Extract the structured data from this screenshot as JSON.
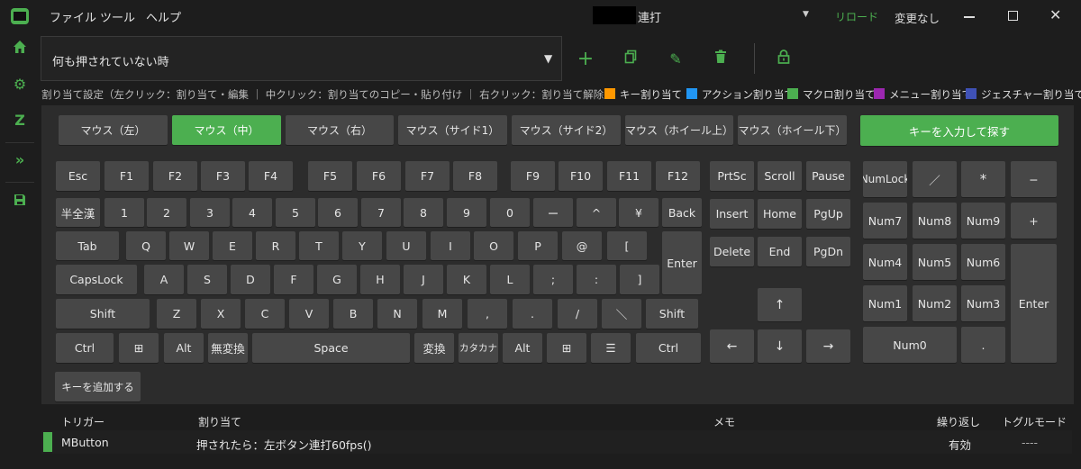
{
  "menu": [
    "ファイル",
    "ツール",
    "ヘルプ"
  ],
  "title": {
    "suffix": "連打"
  },
  "header": {
    "reload": "リロード",
    "status": "変更なし"
  },
  "dropdown": {
    "value": "何も押されていない時"
  },
  "hint": "割り当て設定（左クリック：割り当て・編集 ｜ 中クリック：割り当てのコピー・貼り付け ｜ 右クリック：割り当て解除）",
  "legend": [
    {
      "label": "キー割り当て",
      "color": "#ff9800"
    },
    {
      "label": "アクション割り当て",
      "color": "#2196f3"
    },
    {
      "label": "マクロ割り当て",
      "color": "#4caf50"
    },
    {
      "label": "メニュー割り当て",
      "color": "#9c27b0"
    },
    {
      "label": "ジェスチャー割り当て",
      "color": "#3f51b5"
    }
  ],
  "mouse": [
    "マウス（左）",
    "マウス（中）",
    "マウス（右）",
    "マウス（サイド1）",
    "マウス（サイド2）",
    "マウス（ホイール上）",
    "マウス（ホイール下）"
  ],
  "search_label": "キーを入力して探す",
  "add_key_label": "キーを追加する",
  "keys": {
    "fn": [
      "Esc",
      "F1",
      "F2",
      "F3",
      "F4",
      "F5",
      "F6",
      "F7",
      "F8",
      "F9",
      "F10",
      "F11",
      "F12"
    ],
    "num": [
      "半全漢",
      "1",
      "2",
      "3",
      "4",
      "5",
      "6",
      "7",
      "8",
      "9",
      "0",
      "ー",
      "^",
      "¥",
      "Back"
    ],
    "tab": [
      "Tab",
      "Q",
      "W",
      "E",
      "R",
      "T",
      "Y",
      "U",
      "I",
      "O",
      "P",
      "@",
      "["
    ],
    "caps": [
      "CapsLock",
      "A",
      "S",
      "D",
      "F",
      "G",
      "H",
      "J",
      "K",
      "L",
      ";",
      ":",
      "]"
    ],
    "shift": [
      "Shift",
      "Z",
      "X",
      "C",
      "V",
      "B",
      "N",
      "M",
      ",",
      ".",
      "/",
      "＼",
      "Shift"
    ],
    "bottom": [
      "Ctrl",
      "⊞",
      "Alt",
      "無変換",
      "Space",
      "変換",
      "カタカナ",
      "Alt",
      "⊞",
      "☰",
      "Ctrl"
    ],
    "enter": "Enter",
    "nav": [
      "PrtSc",
      "Scroll",
      "Pause",
      "Insert",
      "Home",
      "PgUp",
      "Delete",
      "End",
      "PgDn"
    ],
    "arrows": [
      "↑",
      "←",
      "↓",
      "→"
    ],
    "numpad": [
      "NumLock",
      "／",
      "*",
      "−",
      "Num7",
      "Num8",
      "Num9",
      "+",
      "Num4",
      "Num5",
      "Num6",
      "Num1",
      "Num2",
      "Num3",
      "Enter",
      "Num0",
      "."
    ]
  },
  "table": {
    "headers": [
      "トリガー",
      "割り当て",
      "メモ",
      "繰り返し",
      "トグルモード"
    ],
    "rows": [
      {
        "trigger": "MButton",
        "assign": "押されたら：左ボタン連打60fps()",
        "memo": "",
        "repeat": "有効",
        "toggle": "----"
      }
    ]
  }
}
